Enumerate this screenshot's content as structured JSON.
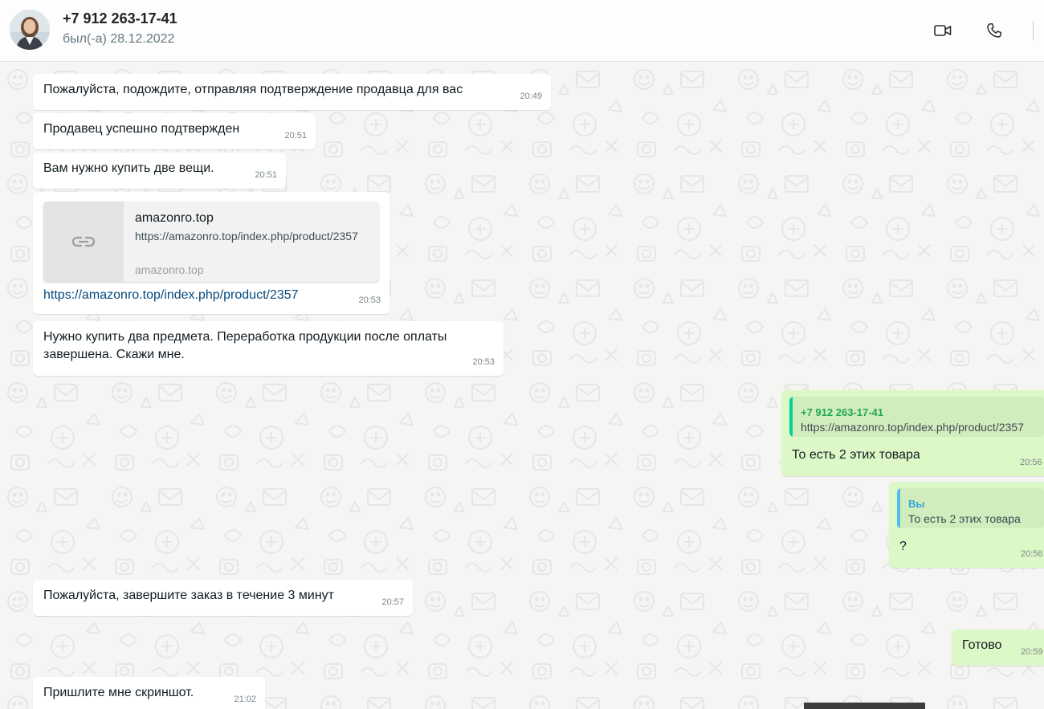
{
  "header": {
    "contact_name": "+7 912 263-17-41",
    "last_seen": "был(-а) 28.12.2022",
    "icons": {
      "video_call": "video-camera-icon",
      "voice_call": "phone-icon"
    }
  },
  "colors": {
    "incoming_bubble": "#ffffff",
    "outgoing_bubble": "#dcf8c6",
    "link": "#064b80",
    "quote_bar_contact": "#06cf9c",
    "quote_bar_you": "#53bdeb"
  },
  "messages": [
    {
      "direction": "in",
      "text": "Пожалуйста, подождите, отправляя подтверждение продавца для вас",
      "time": "20:49"
    },
    {
      "direction": "in",
      "text": "Продавец успешно подтвержден",
      "time": "20:51"
    },
    {
      "direction": "in",
      "text": "Вам нужно купить две вещи.",
      "time": "20:51"
    },
    {
      "direction": "in",
      "preview": {
        "title": "amazonro.top",
        "description": "https://amazonro.top/index.php/product/2357",
        "domain": "amazonro.top",
        "icon": "link-icon"
      },
      "link": "https://amazonro.top/index.php/product/2357",
      "time": "20:53"
    },
    {
      "direction": "in",
      "text_line1": "Нужно купить два предмета. Переработка продукции после оплаты",
      "text_line2": "завершена. Скажи мне.",
      "time": "20:53"
    },
    {
      "direction": "out",
      "quote": {
        "author": "+7 912 263-17-41",
        "text": "https://amazonro.top/index.php/product/2357"
      },
      "text": "То есть 2 этих товара",
      "time": "20:56"
    },
    {
      "direction": "out",
      "quote": {
        "author": "Вы",
        "text": "То есть 2 этих товара"
      },
      "text": "?",
      "time": "20:56"
    },
    {
      "direction": "in",
      "text": "Пожалуйста, завершите заказ в течение 3 минут",
      "time": "20:57"
    },
    {
      "direction": "out",
      "text": "Готово",
      "time": "20:59"
    },
    {
      "direction": "in",
      "text": "Пришлите мне скриншот.",
      "time": "21:02"
    }
  ]
}
